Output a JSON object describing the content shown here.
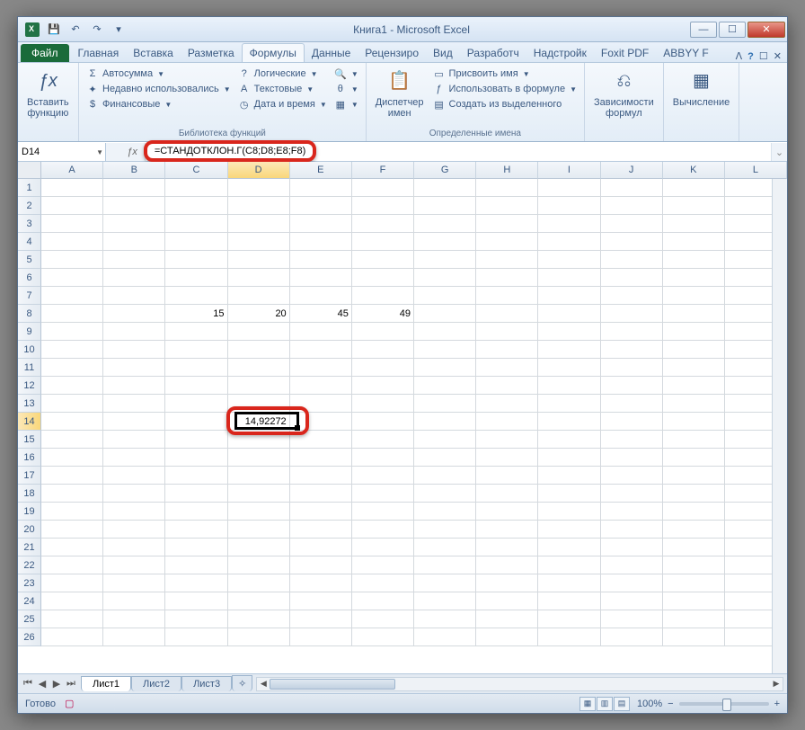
{
  "title": "Книга1 - Microsoft Excel",
  "qat": {
    "save": "💾",
    "undo": "↶",
    "redo": "↷"
  },
  "tabs": {
    "file": "Файл",
    "items": [
      "Главная",
      "Вставка",
      "Разметка",
      "Формулы",
      "Данные",
      "Рецензиро",
      "Вид",
      "Разработч",
      "Надстройк",
      "Foxit PDF",
      "ABBYY F"
    ],
    "active_index": 3
  },
  "ribbon": {
    "insert_fn": {
      "label": "Вставить\nфункцию",
      "icon": "ƒx"
    },
    "lib": {
      "autosum": "Автосумма",
      "recent": "Недавно использовались",
      "financial": "Финансовые",
      "logical": "Логические",
      "text": "Текстовые",
      "datetime": "Дата и время",
      "group": "Библиотека функций"
    },
    "names": {
      "mgr": "Диспетчер\nимен",
      "define": "Присвоить имя",
      "usein": "Использовать в формуле",
      "create": "Создать из выделенного",
      "group": "Определенные имена"
    },
    "deps": {
      "label": "Зависимости\nформул"
    },
    "calc": {
      "label": "Вычисление"
    }
  },
  "namebox": "D14",
  "formula": "=СТАНДОТКЛОН.Г(C8;D8;E8;F8)",
  "columns": [
    "A",
    "B",
    "C",
    "D",
    "E",
    "F",
    "G",
    "H",
    "I",
    "J",
    "K",
    "L"
  ],
  "rows_count": 26,
  "selected_col_index": 3,
  "selected_row_index": 13,
  "data_cells": {
    "r8": {
      "C": "15",
      "D": "20",
      "E": "45",
      "F": "49"
    },
    "r14": {
      "D": "14,92272"
    }
  },
  "sheets": {
    "active": "Лист1",
    "others": [
      "Лист2",
      "Лист3"
    ]
  },
  "status": {
    "ready": "Готово",
    "zoom": "100%"
  }
}
